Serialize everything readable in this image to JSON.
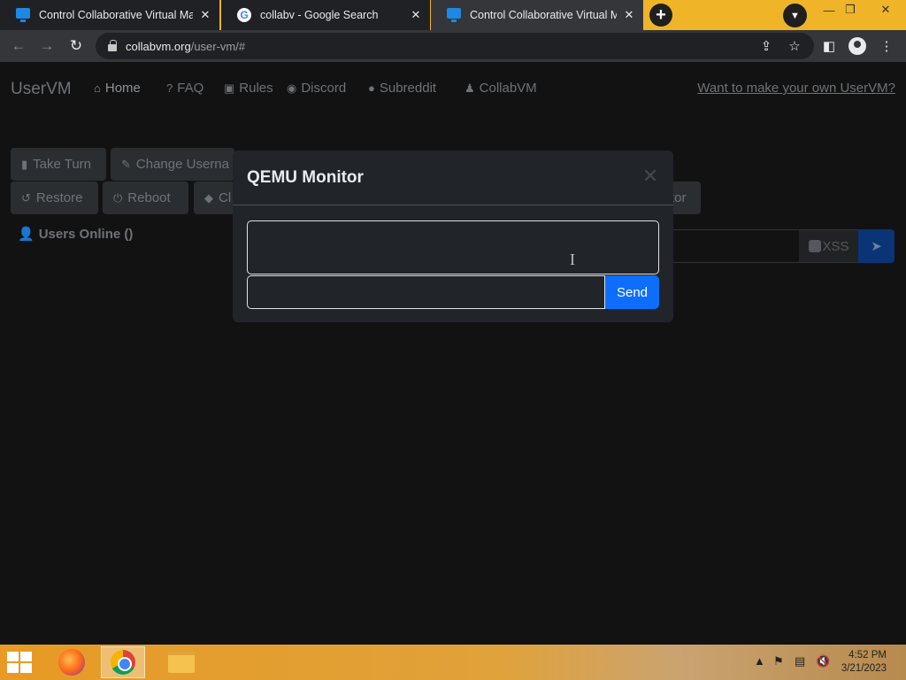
{
  "browser": {
    "tabs": [
      {
        "title": "Control Collaborative Virtual Ma",
        "icon": "monitor-icon",
        "active": false
      },
      {
        "title": "collabv - Google Search",
        "icon": "google-icon",
        "active": false
      },
      {
        "title": "Control Collaborative Virtual Ma",
        "icon": "monitor-icon",
        "active": true
      }
    ],
    "url_host": "collabvm.org",
    "url_path": "/user-vm/#"
  },
  "page": {
    "brand": "UserVM",
    "nav": [
      {
        "label": "Home",
        "icon": "home-icon"
      },
      {
        "label": "FAQ",
        "icon": "question-icon"
      },
      {
        "label": "Rules",
        "icon": "clipboard-icon"
      },
      {
        "label": "Discord",
        "icon": "discord-icon"
      },
      {
        "label": "Subreddit",
        "icon": "reddit-icon"
      },
      {
        "label": "CollabVM",
        "icon": "person-icon"
      }
    ],
    "nav_right": "Want to make your own UserVM?",
    "buttons_row1": [
      {
        "label": "Take Turn",
        "icon": "mouse-icon"
      },
      {
        "label": "Change Userna",
        "icon": "user-edit-icon"
      }
    ],
    "buttons_row2": [
      {
        "label": "Restore",
        "icon": "undo-icon"
      },
      {
        "label": "Reboot",
        "icon": "power-icon"
      },
      {
        "label": "Cl",
        "icon": "eraser-icon"
      },
      {
        "label": "tor",
        "icon": ""
      }
    ],
    "users_online": "Users Online ()",
    "xss_label": "XSS"
  },
  "modal": {
    "title": "QEMU Monitor",
    "output": "",
    "input_value": "",
    "send_label": "Send"
  },
  "taskbar": {
    "apps": [
      "firefox-icon",
      "chrome-icon",
      "folder-icon"
    ],
    "time": "4:52 PM",
    "date": "3/21/2023"
  },
  "colors": {
    "accent": "#0d6efd",
    "tabstrip": "#f0b429",
    "page_bg": "#121212",
    "modal_bg": "#212529"
  }
}
